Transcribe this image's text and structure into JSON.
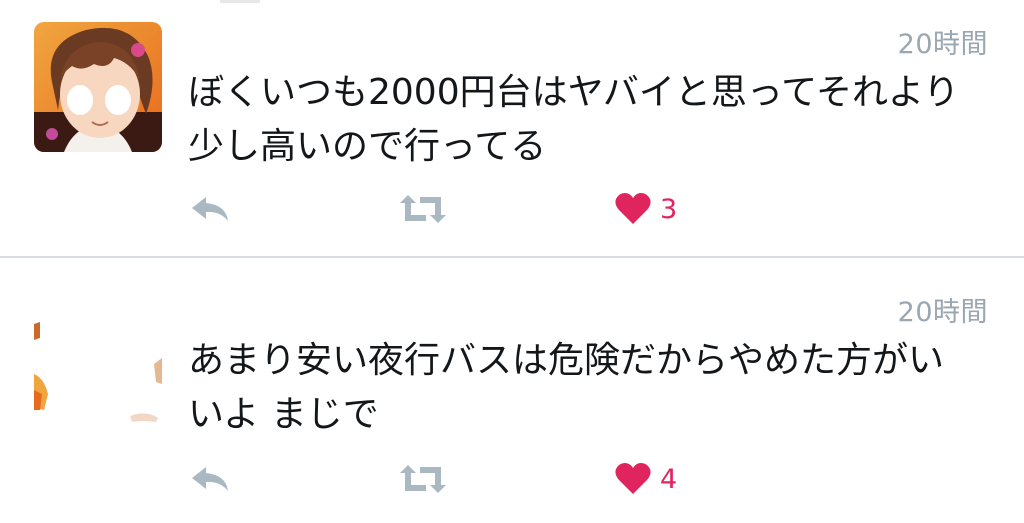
{
  "tweets": [
    {
      "timestamp": "20時間",
      "text_lines": [
        "ぼくいつも2000円台はヤバイと思ってそれより",
        "少し高いので行ってる"
      ],
      "like_count": "3",
      "avatar_icon": "anime-character-avatar-icon"
    },
    {
      "timestamp": "20時間",
      "text_lines": [
        "あまり安い夜行バスは危険だからやめた方がい",
        "いよ まじで"
      ],
      "like_count": "4",
      "avatar_icon": "anime-character-avatar-icon"
    }
  ],
  "icons": {
    "reply": "reply-icon",
    "retweet": "retweet-icon",
    "like": "heart-icon"
  },
  "colors": {
    "text": "#14171a",
    "muted": "#9aa6b1",
    "action_gray": "#aab8c2",
    "like_red": "#e0245e",
    "divider": "#d7dde2"
  }
}
